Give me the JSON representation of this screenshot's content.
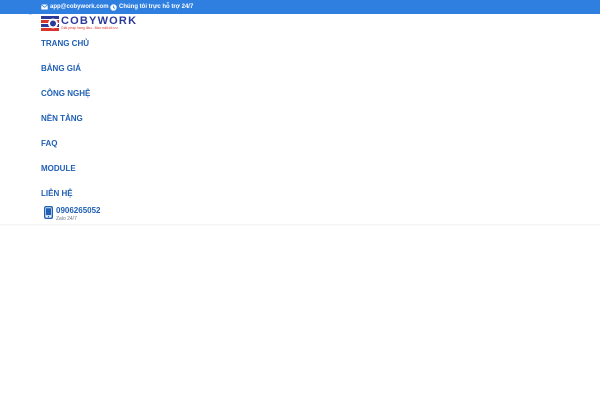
{
  "topbar": {
    "email": "app@cobywork.com",
    "support": "Chúng tôi trực hỗ trợ 24/7"
  },
  "logo": {
    "name": "COBYWORK",
    "tagline": "Giải pháp hàng đầu - Bảo mật tối ưu"
  },
  "nav": {
    "items": [
      {
        "label": "TRANG CHỦ"
      },
      {
        "label": "BẢNG GIÁ"
      },
      {
        "label": "CÔNG NGHỆ"
      },
      {
        "label": "NỀN TẢNG"
      },
      {
        "label": "FAQ"
      },
      {
        "label": "MODULE"
      },
      {
        "label": "LIÊN HỆ"
      }
    ]
  },
  "contact": {
    "phone": "0906265052",
    "sub": "Zalo 24/7"
  },
  "colors": {
    "brand_blue": "#2f7fe0",
    "nav_text": "#1f5fb4",
    "logo_navy": "#2b3a9a",
    "logo_red": "#d9342b"
  },
  "icons": {
    "email": "envelope-icon",
    "support": "clock-icon",
    "phone": "mobile-phone-icon"
  }
}
